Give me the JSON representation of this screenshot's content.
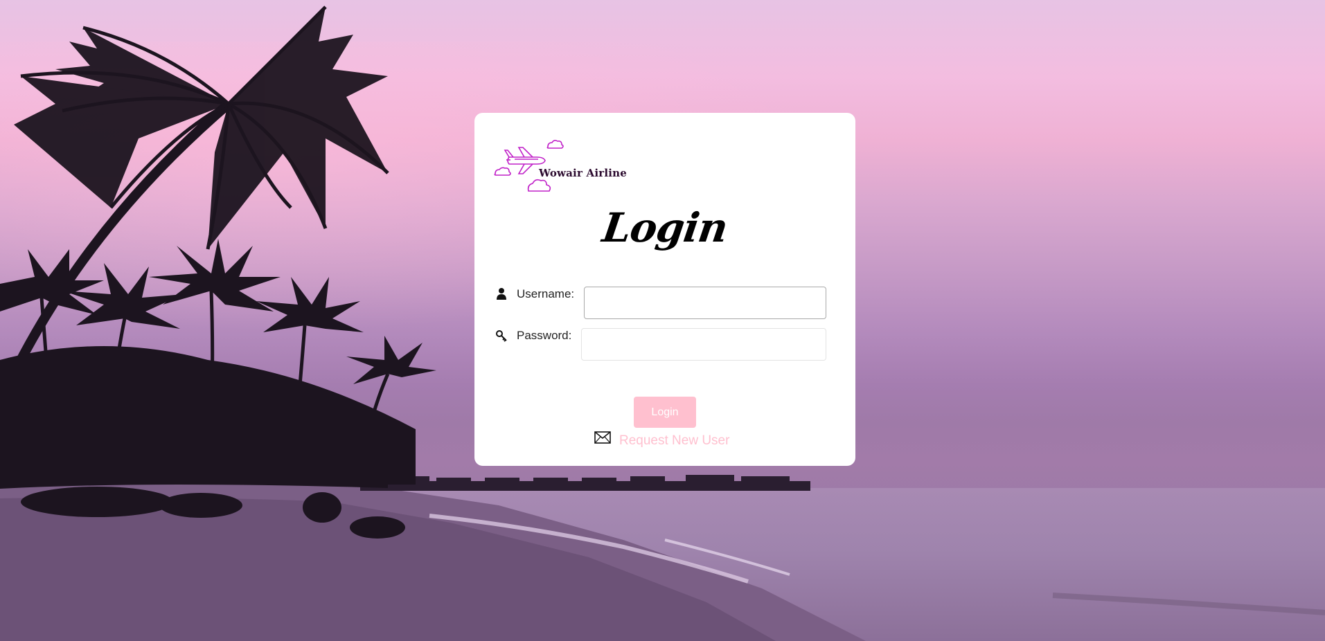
{
  "brand": {
    "name": "Wowair Airline"
  },
  "login": {
    "title": "Login",
    "username_label": "Username:",
    "username_value": "",
    "password_label": "Password:",
    "password_value": "",
    "submit_label": "Login",
    "request_link": "Request New User"
  },
  "icons": {
    "username": "user-icon",
    "password": "key-icon",
    "request": "envelope-icon",
    "logo": "airplane-icon"
  },
  "colors": {
    "accent_pink": "#ffc0cf",
    "logo_purple": "#c020c8",
    "card_bg": "#ffffff"
  }
}
